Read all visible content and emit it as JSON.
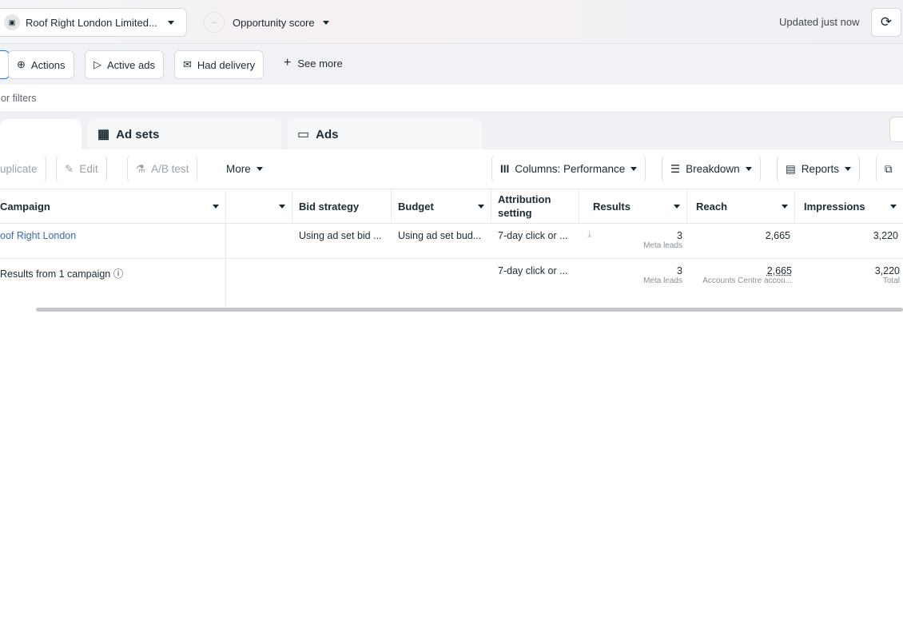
{
  "header": {
    "account": "Roof Right London Limited...",
    "opportunity_score": "Opportunity score",
    "opportunity_value": "--",
    "updated": "Updated just now"
  },
  "filters": {
    "chips": [
      "Actions",
      "Active ads",
      "Had delivery"
    ],
    "see_more": "See more",
    "search_placeholder": "or filters"
  },
  "tabs": {
    "ad_sets": "Ad sets",
    "ads": "Ads"
  },
  "toolbar": {
    "duplicate": "uplicate",
    "edit": "Edit",
    "ab_test": "A/B test",
    "more": "More",
    "columns": "Columns: Performance",
    "breakdown": "Breakdown",
    "reports": "Reports"
  },
  "table": {
    "headers": {
      "campaign": "Campaign",
      "bid_strategy": "Bid strategy",
      "budget": "Budget",
      "attribution": "Attribution setting",
      "results": "Results",
      "reach": "Reach",
      "impressions": "Impressions"
    },
    "row": {
      "campaign": "oof Right London",
      "bid_strategy": "Using ad set bid ...",
      "budget": "Using ad set bud...",
      "attribution": "7-day click or ...",
      "results": "3",
      "results_sub": "Meta leads",
      "reach": "2,665",
      "impressions": "3,220"
    },
    "summary": {
      "campaign": "Results from 1 campaign",
      "attribution": "7-day click or ...",
      "results": "3",
      "results_sub": "Meta leads",
      "reach": "2,665",
      "reach_sub": "Accounts Centre accou...",
      "impressions": "3,220",
      "impressions_sub": "Total"
    }
  }
}
